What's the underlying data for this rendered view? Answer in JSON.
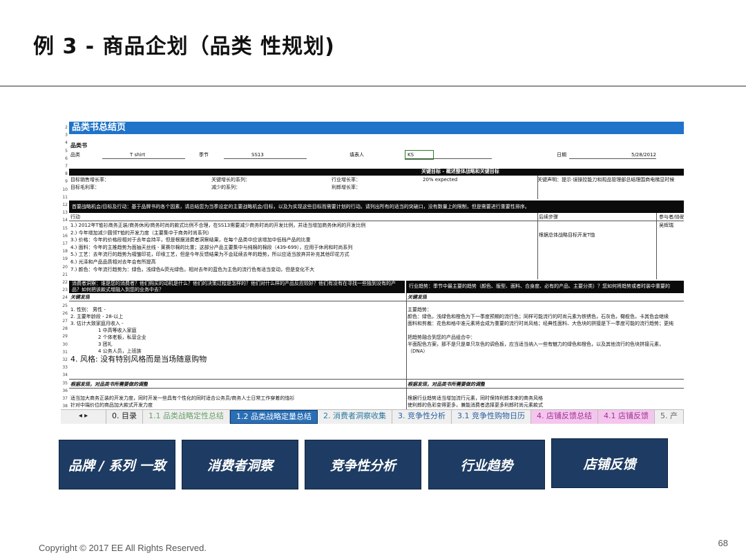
{
  "slide": {
    "title": "例 3 - 商品企划（品类 性规划)",
    "copyright": "Copyright © 2017 EE All Rights Reserved.",
    "page_number": "68"
  },
  "sheet": {
    "banner": "品类书总结页",
    "section_label": "品类书",
    "row_numbers": [
      "2",
      "3",
      "4",
      "5",
      "6",
      "7",
      "8",
      "9",
      "10",
      "11",
      "12",
      "13",
      "14",
      "15",
      "16",
      "17",
      "18",
      "19",
      "20",
      "21",
      "22",
      "23",
      "24",
      "25",
      "26",
      "27",
      "28",
      "29",
      "30",
      "31",
      "32",
      "33",
      "34",
      "35",
      "36",
      "37",
      "38"
    ],
    "info": {
      "category_label": "品类",
      "category_value": "T shirt",
      "season_label": "季节",
      "season_value": "SS13",
      "contact_label": "填表人",
      "contact_value": "KS",
      "date_label": "日期",
      "date_value": "5/28/2012"
    },
    "key_targets_bar": "关键目标 - 概述整体战略和关键目标",
    "targets": {
      "row1": [
        "目标销售增长率：",
        "关键增长的系列：",
        "行业增长率：",
        "20% expected",
        "关键声明：提示·误操控能刀和观品管理部总结理围商电梯显时候"
      ],
      "row2": [
        "目标毛利率：",
        "减少的系列：",
        "利郎增长率："
      ]
    },
    "strategy_bar": "首要战略机会/目标及行动：基于品牌书的各个因素，请总结您为当季设定的主要战略机会/目标，以及为实现这些目标而需要计划的行动。请列出所有的适当的突破口，没有数量上的限制，但是需要进行重要性排序。",
    "action_header": "行动",
    "follow_header": "后续步骤",
    "ref_header": "参与者/协助",
    "actions": [
      "1.) 2012年T恤衫商务正装/商务休闲/商务时尚的款式比例不合理，在SS13需要减少商务时尚的开发比例，并适当增加商务休闲的开发比例",
      "2.) 今年增加减少圆领T恤的开发力度（主要集中于商务时尚系列）",
      "3.) 价格：今年的价格段相对于去年会持平，但是根据消费者洞察结果，在每个品类中应该增加中低档产品的比重",
      "4.) 面料：今年的主推趋势为面抽天丝线 - 莱赛尔棉的比重；这部分产品主要集中与纯棉的棉段（439-699），应用于休闲和时尚系列",
      "5.) 工艺：去年流行的趋势为褶皱印花，印缘工艺，但是今年反馈结果为不会延续去年的趋势，所以应适当放弃并补充其他印花方式",
      "6.) 光泽和产品品质相对去年会有所提高",
      "7.) 颜色：今年流行趋势为：绿色，浅绿色&荧光绿色，相对去年的蓝色为主色的流行色有适当变动，但是变化不大"
    ],
    "follow_text": "根据总体战略目标开发T恤",
    "ref_text": "吴辉瑞",
    "consumer_bar": "消费者洞察：谁是您的消费者？他们购买的动机是什么？他们的决策过程是怎样的？他们对什么样的产品反应较好？他们有没有在寻找一些独到没有的产品？如何把该款式增融入到您的业务中去？",
    "trend_bar": "行业趋势：季节中最主要的趋势（颜色、版型、面料、合身度、必有的产品、主要分类）？您如何将趋势或者时装中重要的",
    "key_findings_label": "关键发现",
    "consumer_findings": [
      "1. 性别：    男性 -",
      "2. 主要年龄段 -       28-以上",
      "3. 估计大致家庭月收入 -",
      "1 中高等收入家庭",
      "2 个体老板，私营企业",
      "3 团礼",
      "4 公务人员，上班族"
    ],
    "consumer_style": "4. 风格: 没有特别风格而是当场随意购物",
    "trend_findings": [
      "主要趋势：",
      "颜色：绿色，浅绿色和橙色为下一季度预期的流行色；同样可能流行的时尚元素为铁锈色，石灰色，橄榄色，卡其色会继续",
      "面料和剪裁：花色和格中准元素将会成为重要的流行时尚风格；经典性面料、大色块的拼接是下一季度可能的流行趋势；更纯",
      "",
      "把趋势融合到您的产品组合中：",
      "半面配色方案，那不是只是单只灰色的调色板，应当适当纳入一些有魅力的绿色和橙色，以及其他流行的色块拼接元素，",
      "（DNA）"
    ],
    "implications_label": "根据发现，对品类书所需要做的调整",
    "consumer_impl": [
      "适当加大商务正装的开发力度，同时开发一些具有个性化的同时适合公务员/商务人士日常工作穿着的恤衫",
      "针对中端价位的商品加大款式开发力度"
    ],
    "trend_impl": [
      "根据行业趋势适当增加流行元素，同时保持利郎本来的商务风格",
      "使利郎的色彩变得更多，兼能消费者选择更多利郎时尚元素款式"
    ]
  },
  "tabs": {
    "nav": "◂  ▸",
    "items": [
      "0. 目录",
      "1.1 品类战略定性总结",
      "1.2 品类战略定量总结",
      "2. 消费者洞察收集",
      "3. 竞争性分析",
      "3.1 竞争性购物日历",
      "4. 店铺反馈总结",
      "4.1 店铺反馈",
      "5. 产"
    ]
  },
  "buttons": [
    "品牌 / 系列 一致",
    "消费者洞察",
    "竞争性分析",
    "行业趋势",
    "店铺反馈"
  ]
}
